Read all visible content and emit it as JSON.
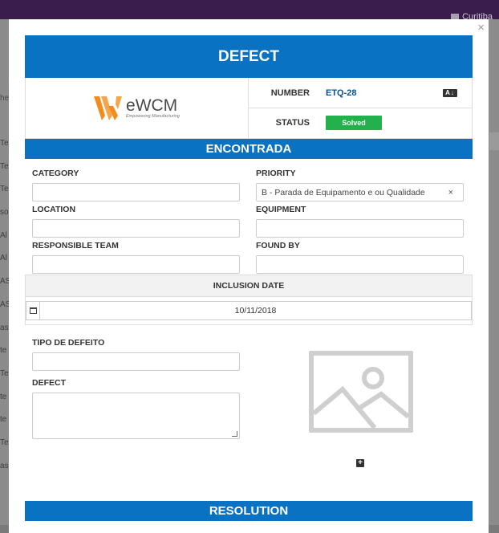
{
  "background": {
    "user_city": "Curitiba",
    "search_fragment": "he",
    "col_fragment": "D",
    "rows": [
      "Te",
      "Te",
      "Te",
      "so",
      "Al",
      "Al",
      "AS",
      "AS",
      "as",
      "te",
      "Te",
      "te",
      "te",
      "Te",
      "as"
    ]
  },
  "modal": {
    "close_symbol": "×",
    "title": "DEFECT",
    "logo": {
      "brand": "eWCM",
      "tagline": "Empowering Manufacturing"
    },
    "number": {
      "label": "NUMBER",
      "value": "ETQ-28",
      "sort_icon_text": "A↓"
    },
    "status": {
      "label": "STATUS",
      "value": "Solved",
      "color": "#22b14c"
    },
    "section_found": "ENCONTRADA",
    "fields": {
      "category": {
        "label": "CATEGORY",
        "value": ""
      },
      "priority": {
        "label": "PRIORITY",
        "value": "B - Parada de Equipamento e ou Qualidade",
        "remove": "×"
      },
      "location": {
        "label": "LOCATION",
        "value": ""
      },
      "equipment": {
        "label": "EQUIPMENT",
        "value": ""
      },
      "responsible_team": {
        "label": "RESPONSIBLE TEAM",
        "value": ""
      },
      "found_by": {
        "label": "FOUND BY",
        "value": ""
      },
      "tipo_de_defeito": {
        "label": "TIPO DE DEFEITO",
        "value": ""
      },
      "defect": {
        "label": "DEFECT",
        "value": ""
      }
    },
    "inclusion_date": {
      "label": "INCLUSION DATE",
      "value": "10/11/2018"
    },
    "add_image_symbol": "+",
    "section_resolution": "RESOLUTION",
    "accent_color": "#0a72c2"
  }
}
